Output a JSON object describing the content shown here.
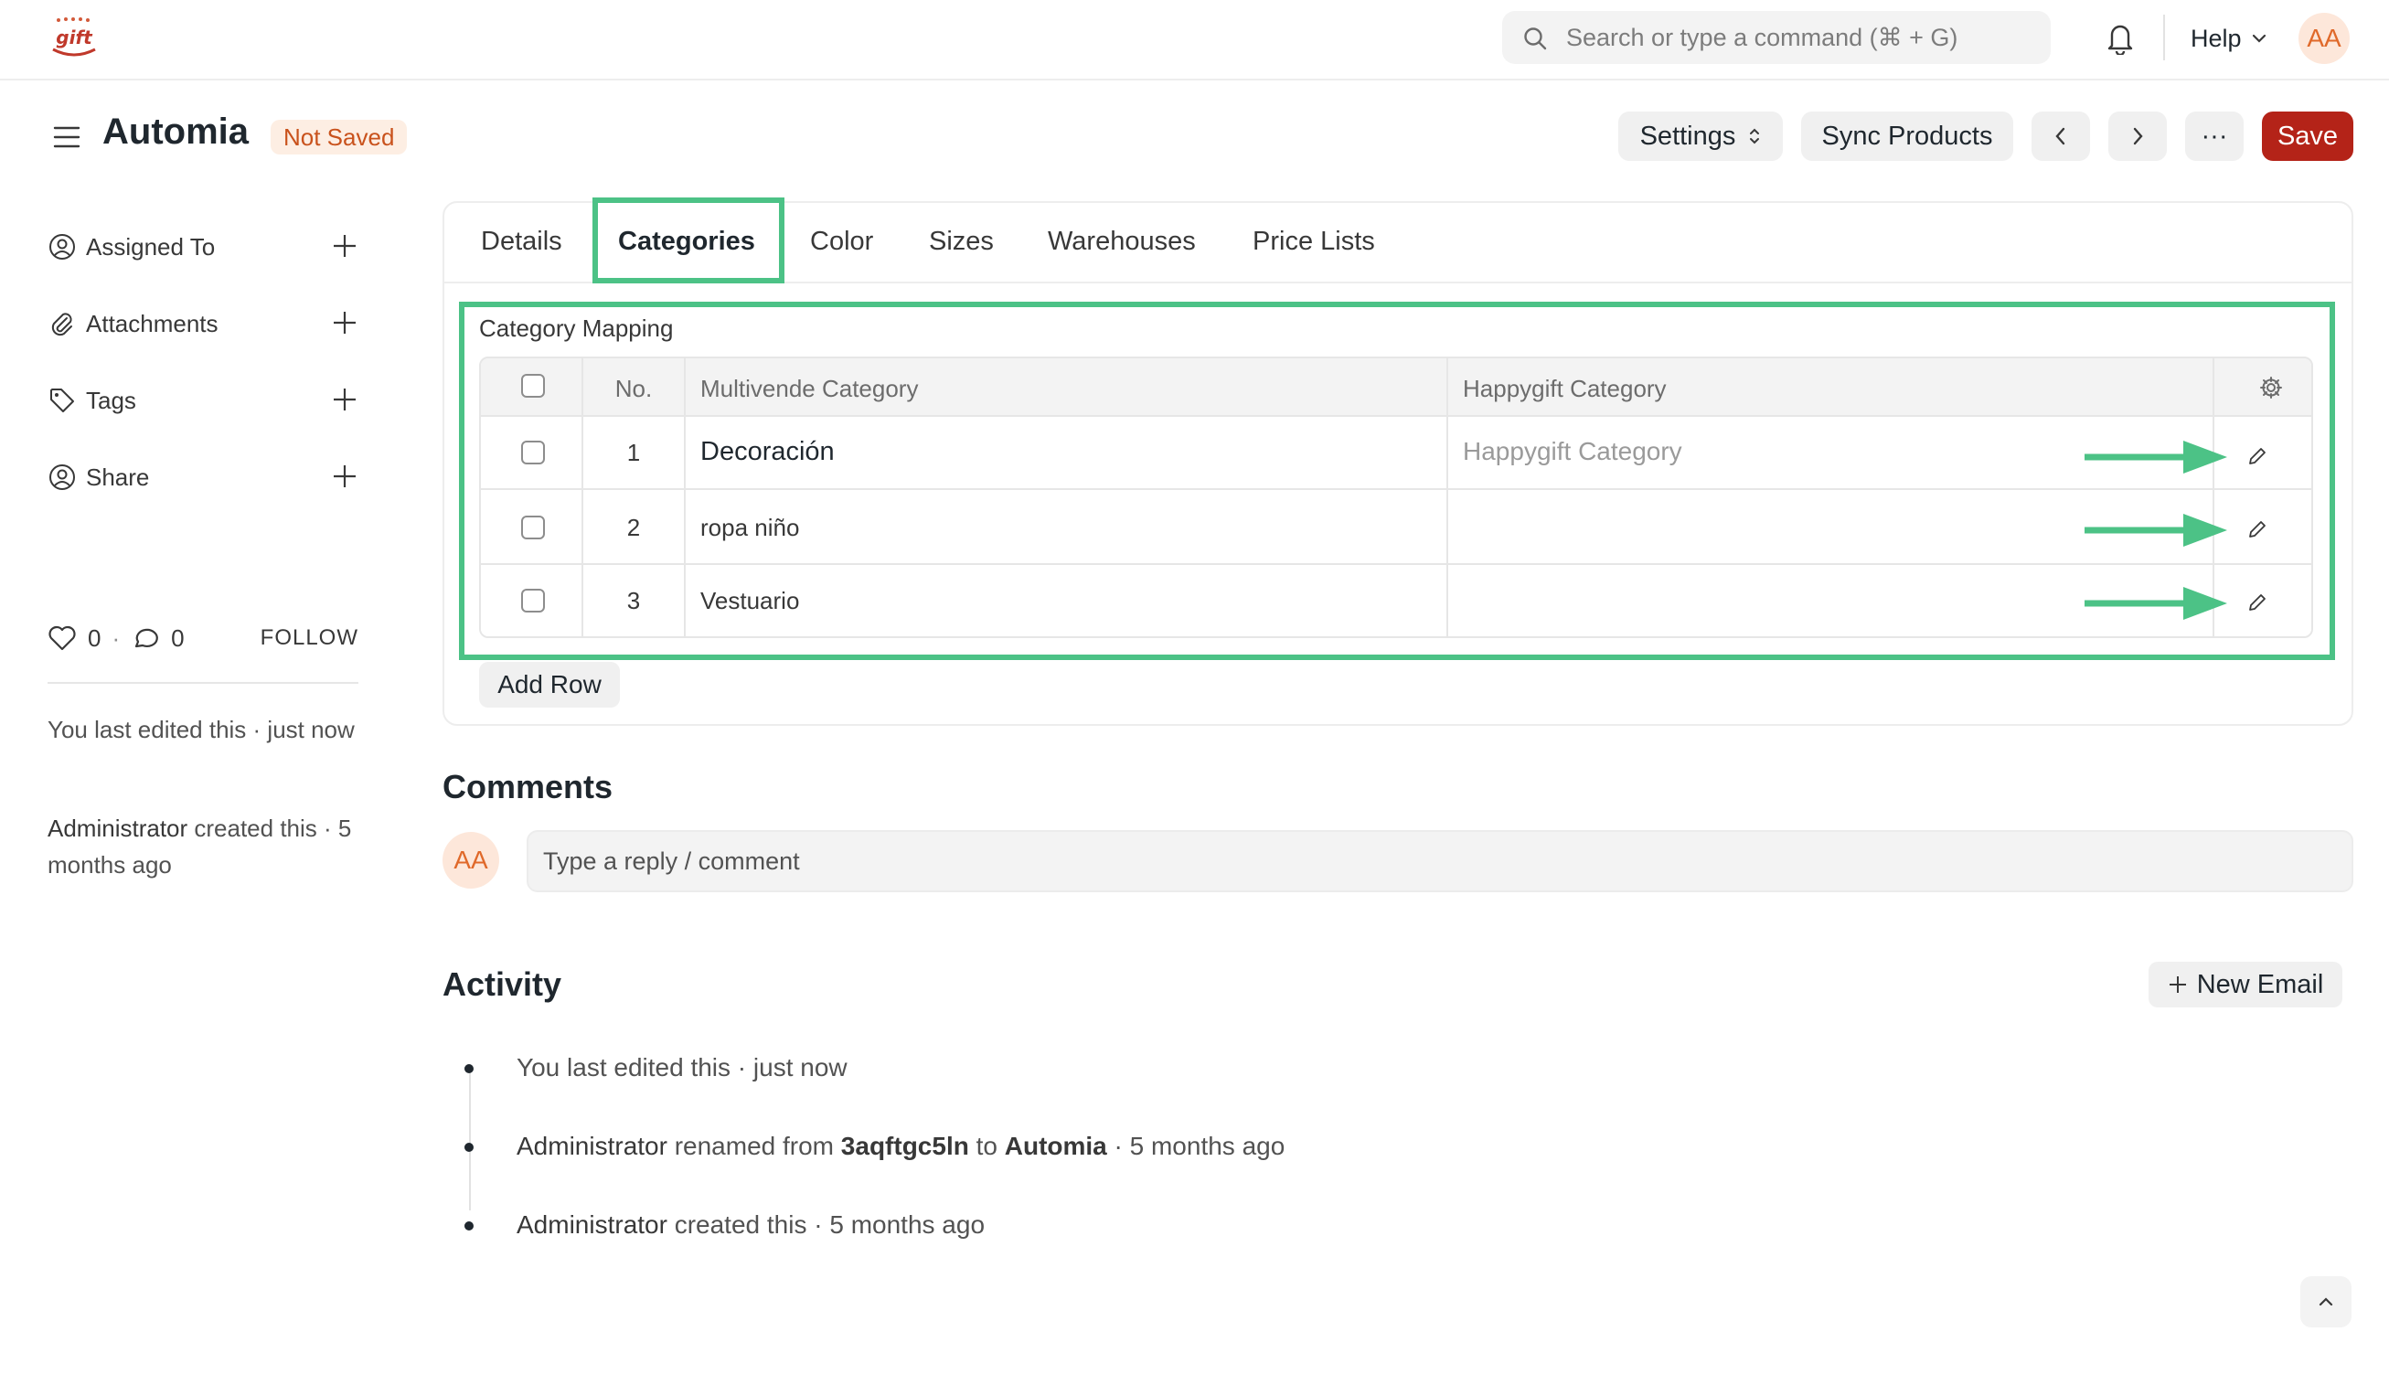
{
  "navbar": {
    "search_placeholder": "Search or type a command (⌘ + G)",
    "help_label": "Help",
    "user_initials": "AA"
  },
  "page": {
    "title": "Automia",
    "status_indicator": "Not Saved",
    "actions": {
      "settings_label": "Settings",
      "sync_label": "Sync Products",
      "more_label": "···",
      "save_label": "Save"
    }
  },
  "sidebar": {
    "items": [
      {
        "label": "Assigned To",
        "icon": "user-circle-icon"
      },
      {
        "label": "Attachments",
        "icon": "paperclip-icon"
      },
      {
        "label": "Tags",
        "icon": "tag-icon"
      },
      {
        "label": "Share",
        "icon": "user-share-icon"
      }
    ],
    "likes_count": "0",
    "comments_count": "0",
    "separator": "·",
    "follow_label": "FOLLOW",
    "last_edited": "You last edited this · just now",
    "created_by": "Administrator",
    "created_suffix": " created this · 5 months ago"
  },
  "tabs": [
    {
      "label": "Details",
      "active": false
    },
    {
      "label": "Categories",
      "active": true
    },
    {
      "label": "Color",
      "active": false
    },
    {
      "label": "Sizes",
      "active": false
    },
    {
      "label": "Warehouses",
      "active": false
    },
    {
      "label": "Price Lists",
      "active": false
    }
  ],
  "category_mapping": {
    "section_label": "Category Mapping",
    "columns": {
      "no": "No.",
      "multivende": "Multivende Category",
      "happygift": "Happygift Category"
    },
    "rows": [
      {
        "no": "1",
        "multivende": "Decoración",
        "happygift": "",
        "happygift_placeholder": "Happygift Category"
      },
      {
        "no": "2",
        "multivende": "ropa niño",
        "happygift": ""
      },
      {
        "no": "3",
        "multivende": "Vestuario",
        "happygift": ""
      }
    ],
    "add_row_label": "Add Row"
  },
  "comments": {
    "heading": "Comments",
    "placeholder": "Type a reply / comment",
    "avatar_initials": "AA"
  },
  "activity": {
    "heading": "Activity",
    "new_email_label": "New Email",
    "items": [
      {
        "text": "You last edited this · just now"
      },
      {
        "actor": "Administrator",
        "pre": " renamed from ",
        "from": "3aqftgc5ln",
        "mid": " to ",
        "to": "Automia",
        "post": " · 5 months ago"
      },
      {
        "actor": "Administrator",
        "post": " created this · 5 months ago"
      }
    ]
  },
  "colors": {
    "highlight": "#4cc286",
    "save_button": "#b42318",
    "not_saved_text": "#c9521c",
    "avatar_bg": "#fde7da"
  }
}
